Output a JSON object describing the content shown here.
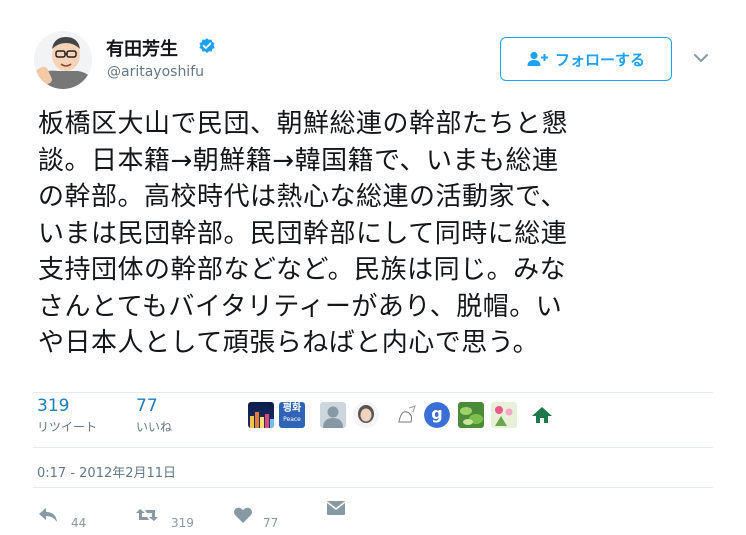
{
  "user": {
    "display_name": "有田芳生",
    "handle": "@aritayoshifu"
  },
  "follow_button": {
    "label": "フォロー",
    "suffix": "する"
  },
  "tweet": {
    "text": "板橋区大山で民団、朝鮮総連の幹部たちと懇\n談。日本籍→朝鮮籍→韓国籍で、いまも総連\nの幹部。高校時代は熱心な総連の活動家で、\nいまは民団幹部。民団幹部にして同時に総連\n支持団体の幹部などなど。民族は同じ。みな\nさんとてもバイタリティーがあり、脱帽。い\nや日本人として頑張らねばと内心で思う。"
  },
  "stats": {
    "retweets": {
      "count": "319",
      "label": "リツイート"
    },
    "likes": {
      "count": "77",
      "label": "いいね"
    }
  },
  "likers": [
    {
      "icon": "night-city-photo"
    },
    {
      "icon": "peace-korean-logo",
      "text": "평화",
      "sub": "Peace"
    },
    {
      "icon": "default-person-avatar"
    },
    {
      "icon": "woman-portrait"
    },
    {
      "icon": "hand-drawn-sketch"
    },
    {
      "icon": "blue-g-logo",
      "text": "g"
    },
    {
      "icon": "green-leaves-photo"
    },
    {
      "icon": "flowers-photo"
    },
    {
      "icon": "green-house-logo"
    }
  ],
  "timestamp": "0:17 - 2012年2月11日",
  "actions": {
    "reply_count": "44",
    "retweet_count": "319",
    "like_count": "77"
  },
  "colors": {
    "accent": "#1da1f2",
    "stat_number": "#1b7ec0",
    "muted": "#657786"
  }
}
